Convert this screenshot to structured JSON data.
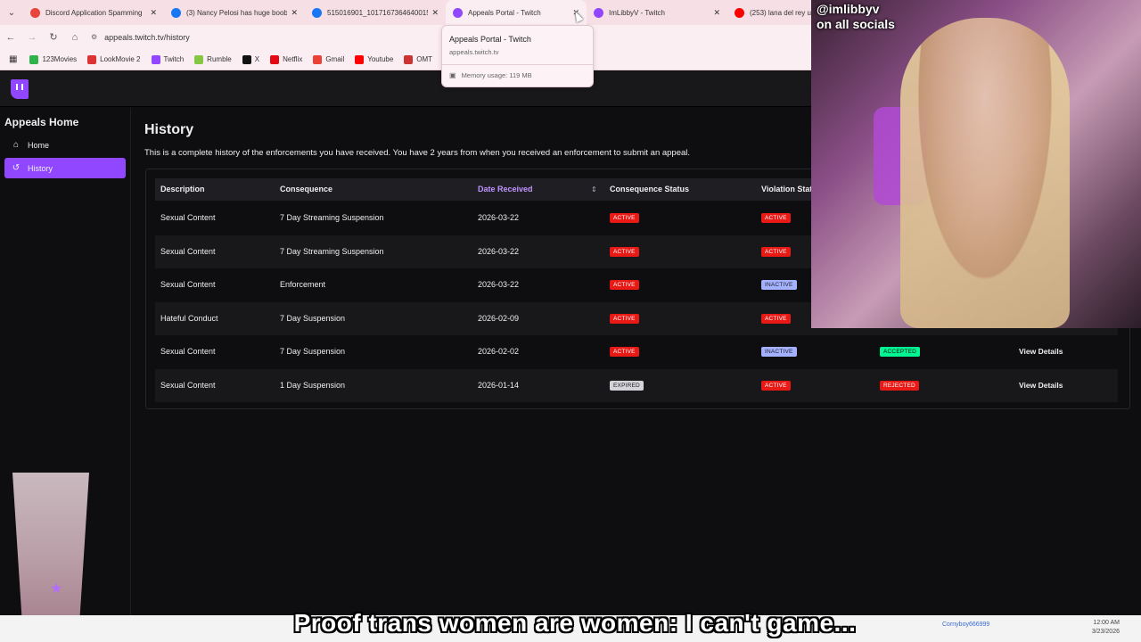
{
  "browser": {
    "tabs": [
      {
        "label": "Discord Application Spamming",
        "icon_color": "#e8453c"
      },
      {
        "label": "(3) Nancy Pelosi has huge boob",
        "icon_color": "#1877f2"
      },
      {
        "label": "515016901_1017167364640015",
        "icon_color": "#1877f2"
      },
      {
        "label": "Appeals Portal - Twitch",
        "icon_color": "#9147ff",
        "active": true
      },
      {
        "label": "ImLibbyV - Twitch",
        "icon_color": "#9147ff"
      },
      {
        "label": "(253) lana del rey u",
        "icon_color": "#ff0000"
      }
    ],
    "url": "appeals.twitch.tv/history",
    "bookmarks": [
      {
        "label": "123Movies",
        "color": "#2db34a"
      },
      {
        "label": "LookMovie 2",
        "color": "#d33"
      },
      {
        "label": "Twitch",
        "color": "#9147ff"
      },
      {
        "label": "Rumble",
        "color": "#85c742"
      },
      {
        "label": "X",
        "color": "#111"
      },
      {
        "label": "Netflix",
        "color": "#e50914"
      },
      {
        "label": "Gmail",
        "color": "#ea4335"
      },
      {
        "label": "Youtube",
        "color": "#ff0000"
      },
      {
        "label": "OMT",
        "color": "#c33"
      }
    ],
    "hover_card": {
      "title": "Appeals Portal - Twitch",
      "url": "appeals.twitch.tv",
      "memory": "Memory usage: 119 MB"
    }
  },
  "sidebar": {
    "title": "Appeals Home",
    "items": [
      {
        "label": "Home",
        "icon": "home-icon"
      },
      {
        "label": "History",
        "icon": "history-icon",
        "active": true
      }
    ]
  },
  "main": {
    "title": "History",
    "description": "This is a complete history of the enforcements you have received. You have 2 years from when you received an enforcement to submit an appeal.",
    "columns": [
      "Description",
      "Consequence",
      "Date Received",
      "Consequence Status",
      "Violation Status"
    ],
    "rows": [
      {
        "description": "Sexual Content",
        "consequence": "7 Day Streaming Suspension",
        "date": "2026-03-22",
        "consequence_status": "ACTIVE",
        "violation_status": "ACTIVE",
        "appeal_status": "",
        "action": ""
      },
      {
        "description": "Sexual Content",
        "consequence": "7 Day Streaming Suspension",
        "date": "2026-03-22",
        "consequence_status": "ACTIVE",
        "violation_status": "ACTIVE",
        "appeal_status": "",
        "action": ""
      },
      {
        "description": "Sexual Content",
        "consequence": "Enforcement",
        "date": "2026-03-22",
        "consequence_status": "ACTIVE",
        "violation_status": "INACTIVE",
        "appeal_status": "",
        "action": ""
      },
      {
        "description": "Hateful Conduct",
        "consequence": "7 Day Suspension",
        "date": "2026-02-09",
        "consequence_status": "ACTIVE",
        "violation_status": "ACTIVE",
        "appeal_status": "",
        "action": ""
      },
      {
        "description": "Sexual Content",
        "consequence": "7 Day Suspension",
        "date": "2026-02-02",
        "consequence_status": "ACTIVE",
        "violation_status": "INACTIVE",
        "appeal_status": "ACCEPTED",
        "action": "View Details"
      },
      {
        "description": "Sexual Content",
        "consequence": "1 Day Suspension",
        "date": "2026-01-14",
        "consequence_status": "EXPIRED",
        "violation_status": "ACTIVE",
        "appeal_status": "REJECTED",
        "action": "View Details"
      }
    ]
  },
  "overlay": {
    "handle_line1": "@imlibbyv",
    "handle_line2": "on all socials",
    "caption": "Proof trans women are women: I can't game...",
    "chat_name": "Cornyboy666999",
    "clock_time": "12:00 AM",
    "clock_date": "3/23/2026"
  }
}
